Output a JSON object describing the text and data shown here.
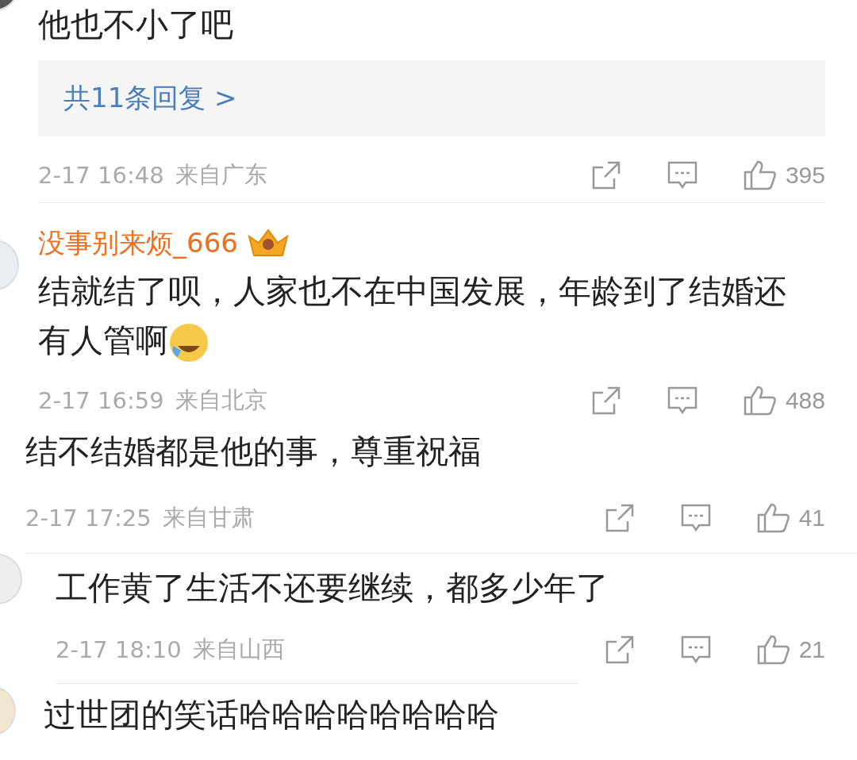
{
  "comments": [
    {
      "text": "他也不小了吧",
      "replies": "共11条回复 >",
      "time": "2-17 16:48",
      "location": "来自广东",
      "likes": "395"
    },
    {
      "name": "没事别来烦_666",
      "text": "结就结了呗，人家也不在中国发展，年龄到了结婚还有人管啊",
      "time": "2-17 16:59",
      "location": "来自北京",
      "likes": "488"
    },
    {
      "text": "结不结婚都是他的事，尊重祝福",
      "time": "2-17 17:25",
      "location": "来自甘肃",
      "likes": "41"
    },
    {
      "text": "工作黄了生活不还要继续，都多少年了",
      "time": "2-17 18:10",
      "location": "来自山西",
      "likes": "21"
    },
    {
      "text": "过世团的笑话哈哈哈哈哈哈哈哈"
    }
  ]
}
